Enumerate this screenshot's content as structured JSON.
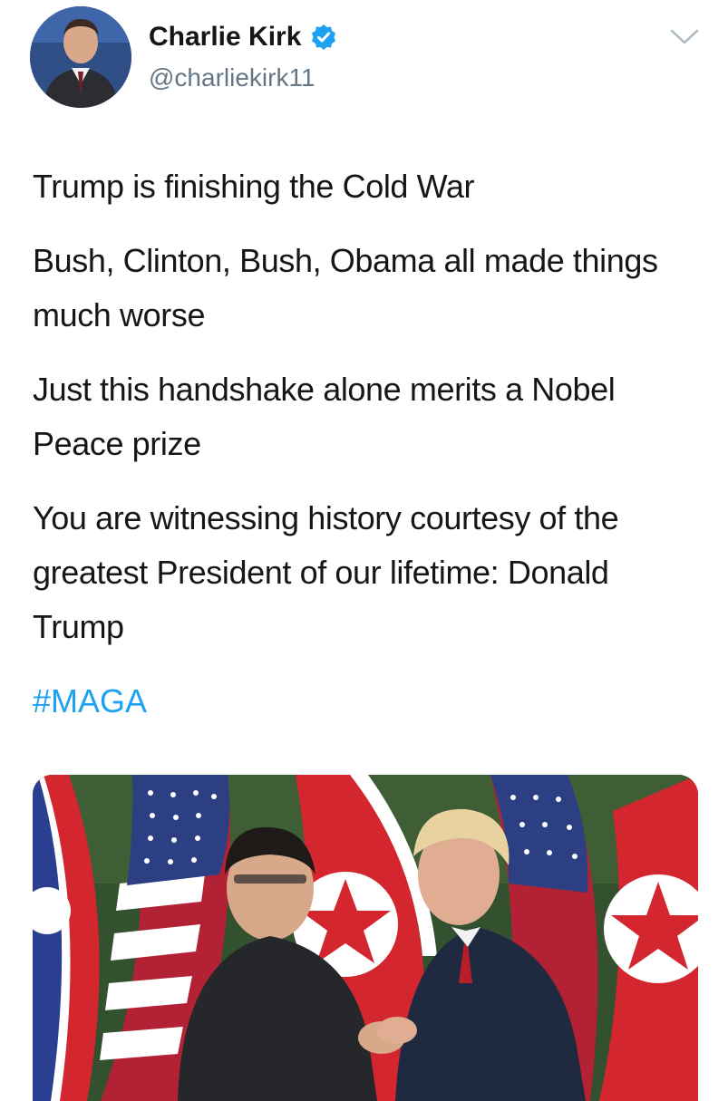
{
  "author": {
    "display_name": "Charlie Kirk",
    "handle": "@charliekirk11",
    "verified": true,
    "avatar_icon": "profile-photo",
    "verified_icon": "verified-badge-icon"
  },
  "menu": {
    "icon": "chevron-down-icon"
  },
  "tweet": {
    "paragraphs": [
      "Trump is finishing the Cold War",
      "Bush, Clinton, Bush, Obama all made things much worse",
      "Just this handshake alone merits a Nobel Peace prize",
      "You are witnessing history courtesy of the greatest President of our lifetime: Donald Trump"
    ],
    "hashtag": "#MAGA"
  },
  "media": {
    "type": "photo",
    "icon": "attached-photo"
  },
  "colors": {
    "link": "#1da1f2",
    "secondary_text": "#657786",
    "primary_text": "#14171a",
    "verified_badge": "#1da1f2"
  }
}
